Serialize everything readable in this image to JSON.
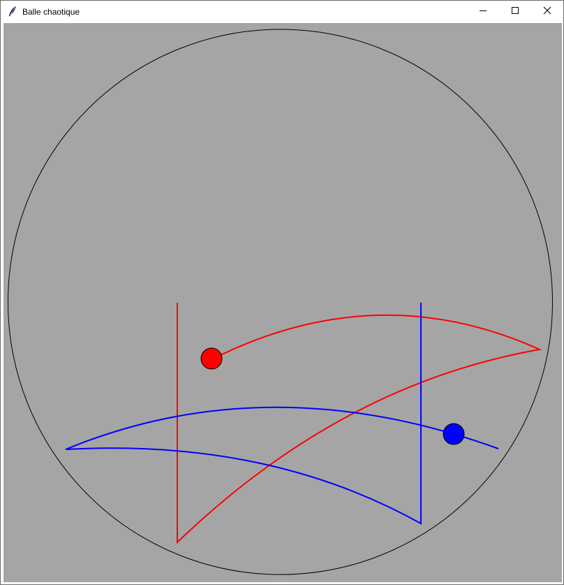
{
  "window": {
    "title": "Balle chaotique",
    "app_icon": "feather-icon",
    "controls": {
      "minimize_icon": "minimize-icon",
      "maximize_icon": "maximize-icon",
      "close_icon": "close-icon"
    }
  },
  "canvas": {
    "background_color": "#a5a5a5",
    "boundary_circle": {
      "color": "#000000"
    },
    "balls": [
      {
        "name": "red-ball",
        "color": "#ff0000"
      },
      {
        "name": "blue-ball",
        "color": "#0000ff"
      }
    ],
    "trails": [
      {
        "name": "red-trail",
        "color": "#ff0000"
      },
      {
        "name": "blue-trail",
        "color": "#0000ff"
      }
    ]
  }
}
